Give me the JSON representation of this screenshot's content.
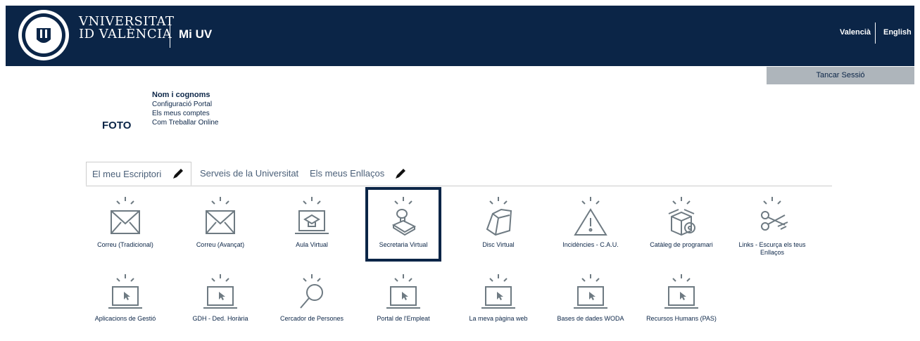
{
  "header": {
    "university_line1": "VNIVERSITAT",
    "university_line2": "ID VALÈNCIA",
    "app_name": "Mi UV",
    "lang_valencia": "Valencià",
    "lang_english": "English",
    "logout": "Tancar Sessió"
  },
  "user": {
    "photo_label": "FOTO",
    "name": "Nom i cognoms",
    "menu": [
      "Configuració Portal",
      "Els meus comptes",
      "Com Treballar Online"
    ]
  },
  "tabs": [
    "El meu Escriptori",
    "Serveis de la Universitat",
    "Els meus Enllaços"
  ],
  "apps_row1": [
    {
      "label": "Correu (Tradicional)",
      "icon": "envelope-icon"
    },
    {
      "label": "Correu (Avançat)",
      "icon": "envelope-icon"
    },
    {
      "label": "Aula Virtual",
      "icon": "aula-virtual-icon"
    },
    {
      "label": "Secretaria Virtual",
      "icon": "stamp-icon"
    },
    {
      "label": "Disc Virtual",
      "icon": "folder-icon"
    },
    {
      "label": "Incidències - C.A.U.",
      "icon": "warning-icon"
    },
    {
      "label": "Catàleg de programari",
      "icon": "software-box-icon"
    },
    {
      "label": "Links - Escurça els teus Enllaços",
      "icon": "scissors-icon"
    }
  ],
  "apps_row2": [
    {
      "label": "Aplicacions de Gestió",
      "icon": "monitor-cursor-icon"
    },
    {
      "label": "GDH - Ded. Horària",
      "icon": "monitor-cursor-icon"
    },
    {
      "label": "Cercador de Persones",
      "icon": "magnifier-icon"
    },
    {
      "label": "Portal de l'Empleat",
      "icon": "monitor-cursor-icon"
    },
    {
      "label": "La meva pàgina web",
      "icon": "monitor-cursor-icon"
    },
    {
      "label": "Bases de dades WODA",
      "icon": "monitor-cursor-icon"
    },
    {
      "label": "Recursos Humans (PAS)",
      "icon": "monitor-cursor-icon"
    }
  ],
  "colors": {
    "header": "#0b2547",
    "logout_bg": "#aeb5bb",
    "icon_gray": "#6e7a82"
  }
}
